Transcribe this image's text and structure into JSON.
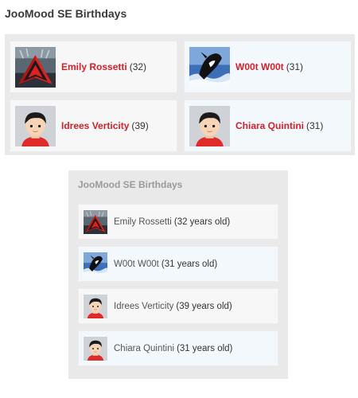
{
  "colors": {
    "accent_link": "#d3222a",
    "panel_bg": "#e9e9e9",
    "card_bg": "#f7f7f7",
    "card_bg_alt": "#f3f8fd"
  },
  "widget_grid": {
    "title": "JooMood SE Birthdays",
    "members": [
      {
        "name": "Emily Rossetti",
        "age": "(32)",
        "avatar": "red-arrow-logo-icon"
      },
      {
        "name": "W00t W00t",
        "age": "(31)",
        "avatar": "orca-whale-icon"
      },
      {
        "name": "Idrees Verticity",
        "age": "(39)",
        "avatar": "default-user-avatar-icon"
      },
      {
        "name": "Chiara Quintini",
        "age": "(31)",
        "avatar": "default-user-avatar-icon"
      }
    ]
  },
  "widget_list": {
    "title": "JooMood SE Birthdays",
    "members": [
      {
        "name": "Emily Rossetti",
        "age": "(32 years old)",
        "avatar": "red-arrow-logo-icon"
      },
      {
        "name": "W00t W00t",
        "age": "(31 years old)",
        "avatar": "orca-whale-icon"
      },
      {
        "name": "Idrees Verticity",
        "age": "(39 years old)",
        "avatar": "default-user-avatar-icon"
      },
      {
        "name": "Chiara Quintini",
        "age": "(31 years old)",
        "avatar": "default-user-avatar-icon"
      }
    ]
  }
}
